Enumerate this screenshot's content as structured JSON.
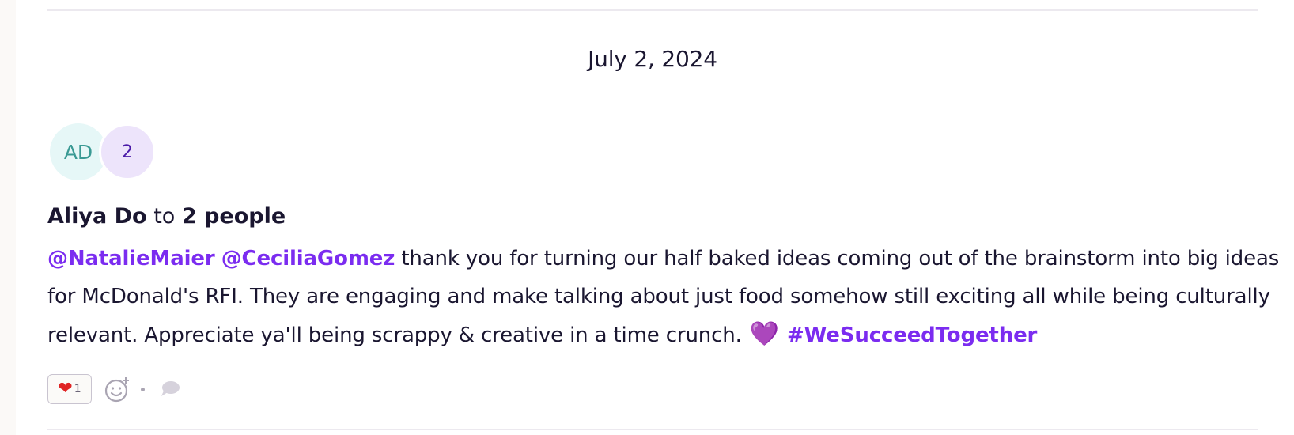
{
  "feed_item": {
    "date": "July 2, 2024",
    "avatars": {
      "sender_initials": "AD",
      "recipient_count": "2"
    },
    "header": {
      "sender_name": "Aliya Do",
      "connector": "to",
      "recipients": "2 people"
    },
    "message": {
      "mention_1": "@NatalieMaier",
      "mention_2": "@CeciliaGomez",
      "body": "thank you for turning our half baked ideas coming out of the brainstorm into big ideas for McDonald's RFI. They are engaging and make talking about just food somehow still exciting all while being culturally relevant. Appreciate ya'll being scrappy & creative in a time crunch.",
      "emoji": "💜",
      "hashtag": "#WeSucceedTogether"
    },
    "reactions": {
      "heart_emoji": "❤",
      "heart_count": "1",
      "add_reaction_icon": "smiley-plus-icon",
      "comment_icon": "speech-bubble-icon"
    }
  },
  "colors": {
    "mention": "#7b2cf0",
    "text": "#1a1630",
    "avatar_ad_bg": "#e6f7f7",
    "avatar_ad_text": "#3a9a94",
    "avatar_count_bg": "#ede4fb",
    "avatar_count_text": "#4a1aa8",
    "reaction_heart": "#e02424"
  }
}
